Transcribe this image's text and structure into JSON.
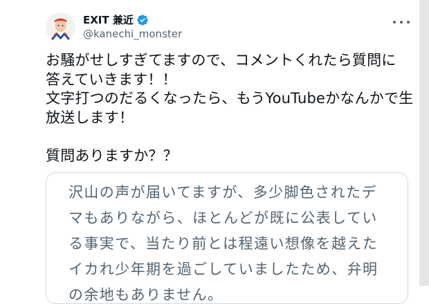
{
  "user": {
    "display_name": "EXIT 兼近",
    "handle": "@kanechi_monster",
    "verified": true,
    "avatar_icon": "profile-photo"
  },
  "menu": {
    "icon": "more-horizontal-icon"
  },
  "tweet": {
    "text": "お騒がせしすぎてますので、コメントくれたら質問に\n答えていきます！！\n文字打つのだるくなったら、もうYouTubeかなんかで生\n放送します！\n\n質問ありますか？？"
  },
  "quote": {
    "text": "沢山の声が届いてますが、多少脚色されたデ\nマもありながら、ほとんどが既に公表してい\nる事実で、当たり前とは程遠い想像を越えた\nイカれ少年期を過ごしていましたため、弁明\nの余地もありません。"
  },
  "colors": {
    "text": "#0f1419",
    "secondary": "#536471",
    "verified": "#1d9bf0",
    "border": "#cfd9de"
  }
}
